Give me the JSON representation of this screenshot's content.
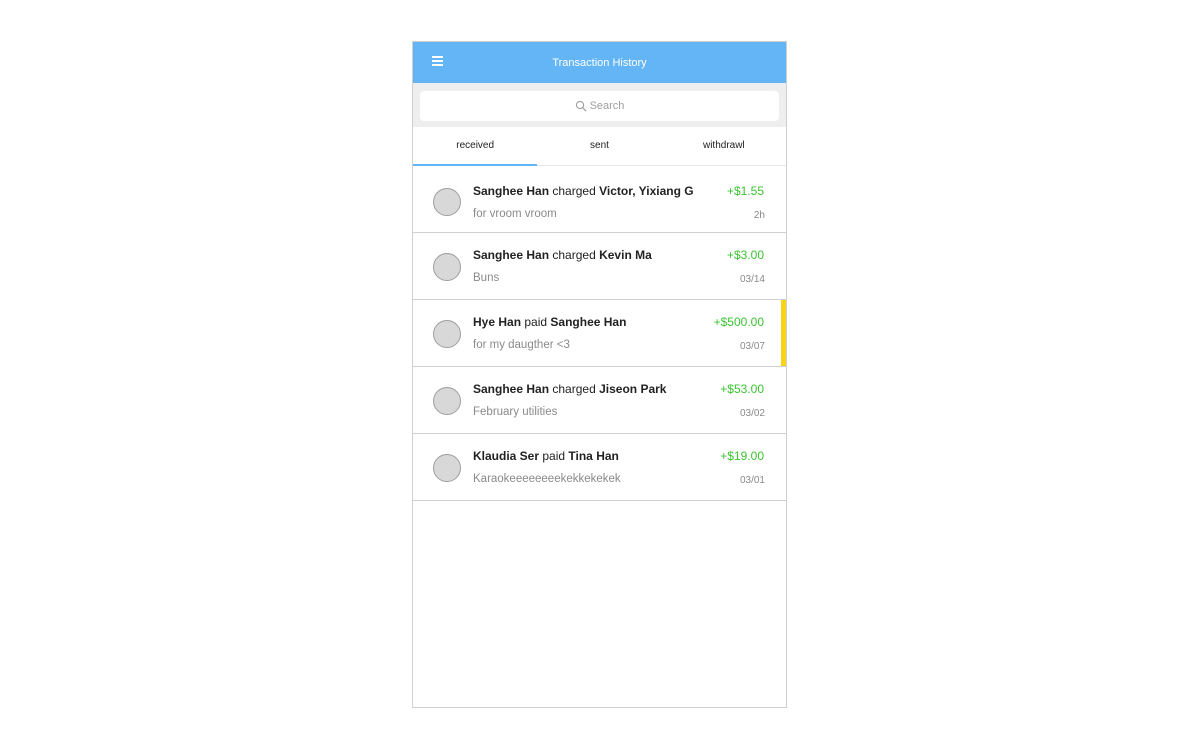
{
  "header": {
    "title": "Transaction History",
    "menu_icon": "hamburger-menu-icon",
    "background_color": "#64b5f6"
  },
  "search": {
    "placeholder": "Search",
    "icon": "search-icon"
  },
  "tabs": [
    {
      "label": "received",
      "active": true
    },
    {
      "label": "sent",
      "active": false
    },
    {
      "label": "withdrawl",
      "active": false
    }
  ],
  "transactions": [
    {
      "from": "Sanghee Han",
      "action": "charged",
      "to": "Victor, Yixiang G",
      "description": "for vroom vroom",
      "amount": "+$1.55",
      "time": "2h",
      "highlighted": false
    },
    {
      "from": "Sanghee Han",
      "action": "charged",
      "to": "Kevin Ma",
      "description": "Buns",
      "amount": "+$3.00",
      "time": "03/14",
      "highlighted": false
    },
    {
      "from": "Hye Han",
      "action": "paid",
      "to": "Sanghee Han",
      "description": "for my daugther <3",
      "amount": "+$500.00",
      "time": "03/07",
      "highlighted": true
    },
    {
      "from": "Sanghee Han",
      "action": "charged",
      "to": "Jiseon Park",
      "description": "February utilities",
      "amount": "+$53.00",
      "time": "03/02",
      "highlighted": false
    },
    {
      "from": "Klaudia Ser",
      "action": "paid",
      "to": "Tina Han",
      "description": "Karaokeeeeeeeekekkekekek",
      "amount": "+$19.00",
      "time": "03/01",
      "highlighted": false
    }
  ],
  "colors": {
    "accent": "#64b5f6",
    "amount_positive": "#3ac430",
    "highlight_marker": "#f7d417"
  }
}
